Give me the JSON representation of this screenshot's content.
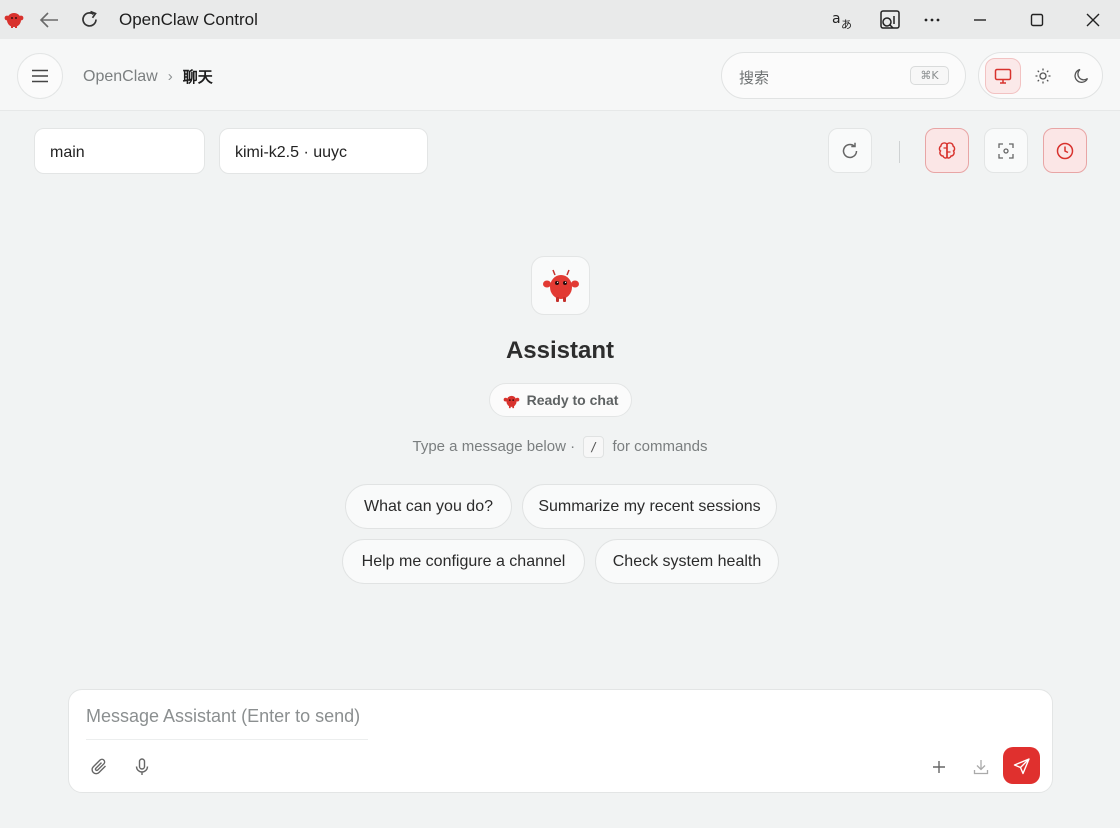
{
  "window": {
    "title": "OpenClaw Control"
  },
  "header": {
    "breadcrumb_root": "OpenClaw",
    "breadcrumb_sep": "›",
    "breadcrumb_current": "聊天",
    "search_placeholder": "搜索",
    "search_shortcut": "⌘K",
    "theme_options": [
      "system-monitor-icon",
      "sun-icon",
      "moon-icon"
    ],
    "theme_selected": "system"
  },
  "controls": {
    "session": "main",
    "model": "kimi-k2.5 · uuyc"
  },
  "welcome": {
    "assistant_name": "Assistant",
    "status": "Ready to chat",
    "hint_before": "Type a message below ·",
    "hint_key": "/",
    "hint_after": "for commands",
    "suggestions": [
      "What can you do?",
      "Summarize my recent sessions",
      "Help me configure a channel",
      "Check system health"
    ]
  },
  "composer": {
    "placeholder": "Message Assistant (Enter to send)"
  },
  "colors": {
    "accent": "#e0302e",
    "accent_soft": "#fbe6e6",
    "background": "#f1f3f3"
  }
}
